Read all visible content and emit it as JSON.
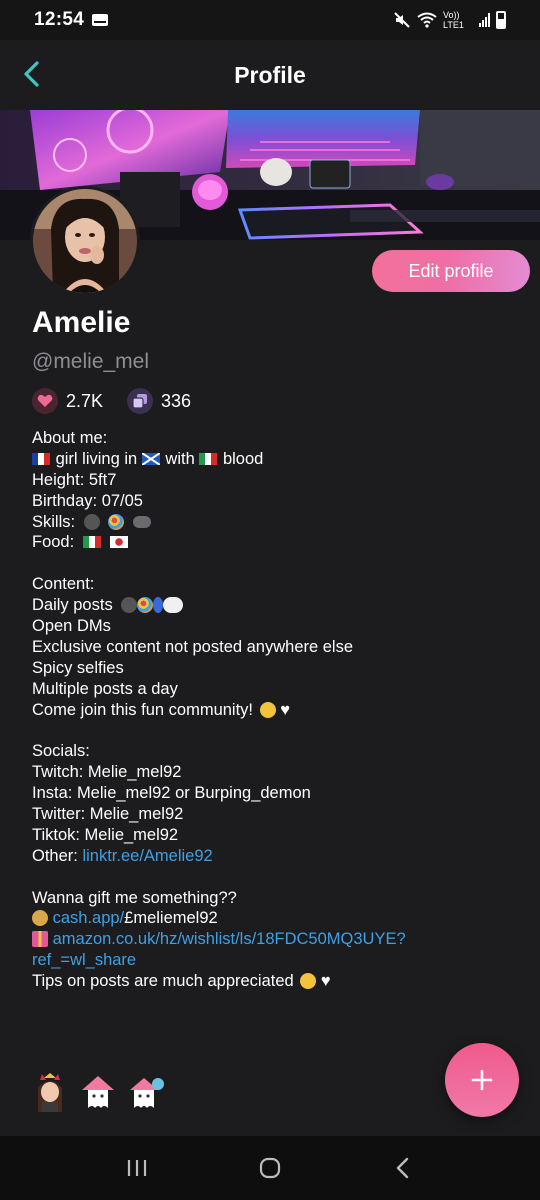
{
  "status_bar": {
    "time": "12:54",
    "network_label": "Vo)) LTE1"
  },
  "header": {
    "title": "Profile"
  },
  "profile": {
    "edit_button_label": "Edit profile",
    "display_name": "Amelie",
    "username": "@melie_mel",
    "stats": {
      "likes": "2.7K",
      "posts": "336"
    }
  },
  "bio": {
    "about_heading": "About me:",
    "about_line1_a": "girl living in",
    "about_line1_b": "with",
    "about_line1_c": "blood",
    "height": "Height: 5ft7",
    "birthday": "Birthday: 07/05",
    "skills": "Skills:",
    "food": "Food:",
    "content_heading": "Content:",
    "daily_posts": "Daily posts",
    "open_dms": "Open DMs",
    "exclusive": "Exclusive content not posted anywhere else",
    "spicy": "Spicy selfies",
    "multiple": "Multiple posts a day",
    "come_join": "Come join this fun community!",
    "socials_heading": "Socials:",
    "twitch": "Twitch: Melie_mel92",
    "insta": "Insta: Melie_mel92 or Burping_demon",
    "twitter": "Twitter: Melie_mel92",
    "tiktok": "Tiktok: Melie_mel92",
    "other_label": "Other:",
    "other_link": "linktr.ee/Amelie92",
    "gift_heading": "Wanna gift me something??",
    "cash_link_a": "cash.app/",
    "cash_link_b": "£meliemel92",
    "amazon_link1": "amazon.co.uk/hz/wishlist/ls/18FDC50MQ3UYE?",
    "amazon_link2": "ref_=wl_share",
    "tips": "Tips on posts are much appreciated"
  },
  "colors": {
    "accent_pink": "#f06a98",
    "link_blue": "#3ea0e6",
    "background": "#1c1c1e",
    "header_teal": "#3ec6c0"
  },
  "icons": {
    "back": "chevron-left-icon",
    "likes": "heart-icon",
    "posts": "stack-icon",
    "fab": "plus-icon"
  }
}
